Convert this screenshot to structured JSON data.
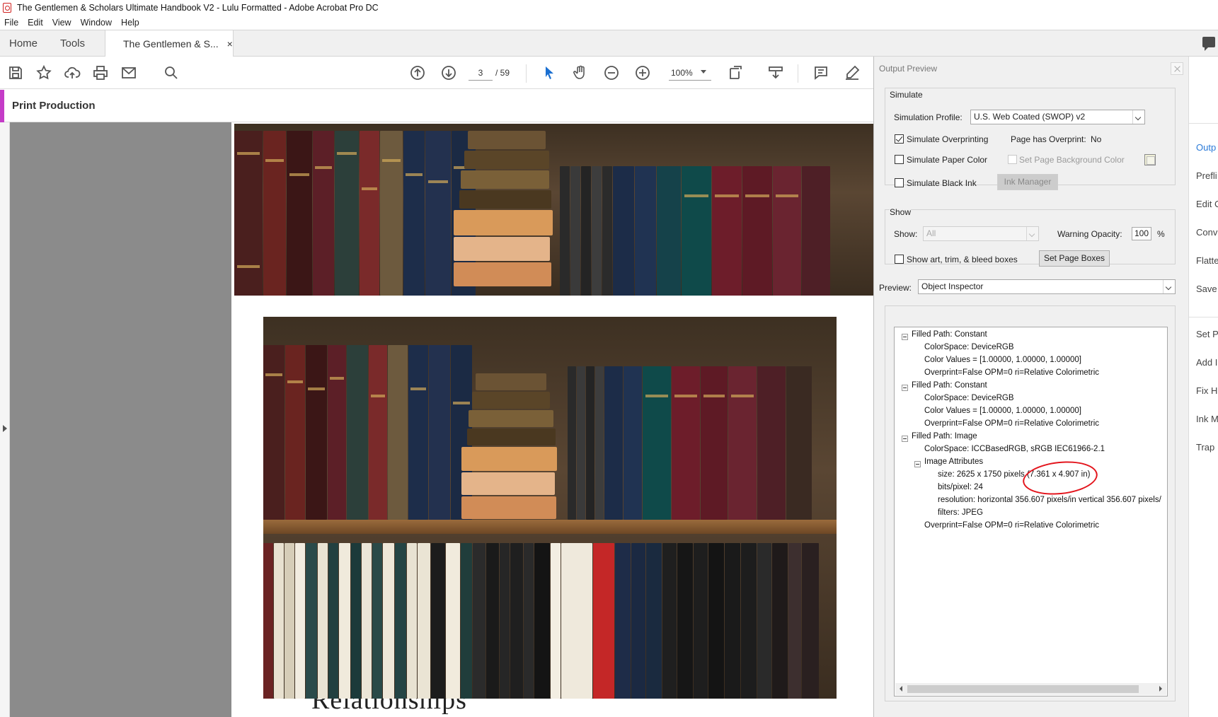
{
  "window": {
    "title": "The Gentlemen & Scholars Ultimate Handbook V2 - Lulu Formatted - Adobe Acrobat Pro DC"
  },
  "menu": [
    "File",
    "Edit",
    "View",
    "Window",
    "Help"
  ],
  "tabs": {
    "home": "Home",
    "tools": "Tools",
    "document": "The Gentlemen & S...",
    "close": "×"
  },
  "toolbar": {
    "current_page": "3",
    "page_total": "/ 59",
    "zoom": "100%"
  },
  "print_production": {
    "label": "Print Production"
  },
  "document": {
    "bottom_text": "Relationships"
  },
  "output_preview": {
    "title": "Output Preview",
    "simulate": {
      "group_label": "Simulate",
      "profile_label": "Simulation Profile:",
      "profile_value": "U.S. Web Coated (SWOP) v2",
      "overprinting_label": "Simulate Overprinting",
      "overprinting_checked": true,
      "page_has_overprint_label": "Page has Overprint:",
      "page_has_overprint_value": "No",
      "paper_color_label": "Simulate Paper Color",
      "page_bg_label": "Set Page Background Color",
      "black_ink_label": "Simulate Black Ink",
      "ink_manager_label": "Ink Manager"
    },
    "show": {
      "group_label": "Show",
      "show_label": "Show:",
      "show_value": "All",
      "warning_label": "Warning Opacity:",
      "warning_value": "100",
      "warning_unit": "%",
      "boxes_label": "Show art, trim, & bleed boxes",
      "set_boxes_label": "Set Page Boxes"
    },
    "preview": {
      "label": "Preview:",
      "value": "Object Inspector"
    },
    "inspector": [
      "Filled Path: Constant",
      "ColorSpace: DeviceRGB",
      "Color Values = [1.00000, 1.00000, 1.00000]",
      "Overprint=False OPM=0 ri=Relative Colorimetric",
      "Filled Path: Constant",
      "ColorSpace: DeviceRGB",
      "Color Values = [1.00000, 1.00000, 1.00000]",
      "Overprint=False OPM=0 ri=Relative Colorimetric",
      "Filled Path: Image",
      "ColorSpace: ICCBasedRGB, sRGB IEC61966-2.1",
      "Image Attributes",
      "size: 2625 x 1750 pixels (7.361 x 4.907 in)",
      "bits/pixel: 24",
      "resolution: horizontal 356.607 pixels/in vertical 356.607 pixels/",
      "filters: JPEG",
      "Overprint=False OPM=0 ri=Relative Colorimetric"
    ]
  },
  "right_rail": [
    "Outp",
    "Prefli",
    "Edit C",
    "Conv",
    "Flatte",
    "Save",
    "Set P",
    "Add I",
    "Fix H",
    "Ink M",
    "Trap"
  ]
}
